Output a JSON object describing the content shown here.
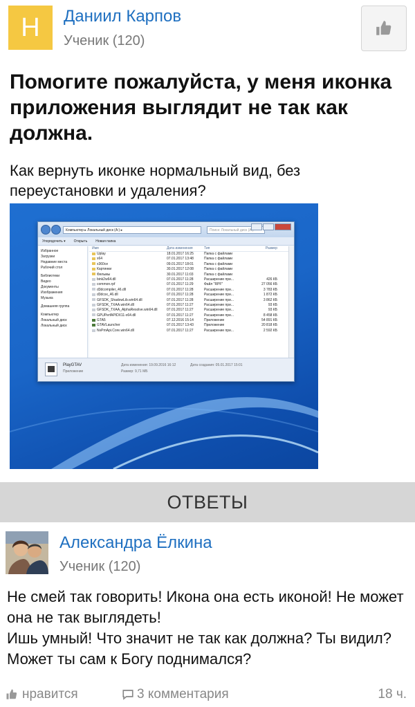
{
  "question": {
    "author": {
      "avatar_letter": "Н",
      "name": "Даниил Карпов",
      "rank": "Ученик (120)"
    },
    "like_icon": "thumbs-up-icon",
    "title": "Помогите пожалуйста, у меня иконка приложения выглядит не так как должна.",
    "body": "Как вернуть иконке нормальный вид, без переустановки и удаления?",
    "screenshot": {
      "address": "Компьютер ▸ Локальный диск (A:) ▸",
      "search_placeholder": "Поиск: Локальный диск (A:)",
      "toolbar": [
        "Упорядочить ▾",
        "Открыть",
        "Новая папка"
      ],
      "nav": [
        "Избранное",
        "Загрузки",
        "Недавние места",
        "Рабочий стол",
        "Библиотеки",
        "Видео",
        "Документы",
        "Изображения",
        "Музыка",
        "Домашняя группа",
        "Компьютер",
        "Локальный диск",
        "Локальный диск"
      ],
      "columns": [
        "Имя",
        "Дата изменения",
        "Тип",
        "Размер"
      ],
      "files": [
        {
          "name": "Uplay",
          "date": "18.01.2017 16:25",
          "type": "Папка с файлами",
          "size": "",
          "kind": "folder"
        },
        {
          "name": "x64",
          "date": "07.01.2017 13:48",
          "type": "Папка с файлами",
          "size": "",
          "kind": "folder"
        },
        {
          "name": "x360ce",
          "date": "09.01.2017 18:01",
          "type": "Папка с файлами",
          "size": "",
          "kind": "folder"
        },
        {
          "name": "Картинки",
          "date": "30.01.2017 12:08",
          "type": "Папка с файлами",
          "size": "",
          "kind": "folder"
        },
        {
          "name": "Фильмы",
          "date": "30.01.2017 11:03",
          "type": "Папка с файлами",
          "size": "",
          "kind": "folder"
        },
        {
          "name": "bink2w64.dll",
          "date": "07.01.2017 11:28",
          "type": "Расширение при...",
          "size": "426 КБ",
          "kind": "file"
        },
        {
          "name": "common.rpf",
          "date": "07.01.2017 11:29",
          "type": "Файл \"RPF\"",
          "size": "27 056 КБ",
          "kind": "file"
        },
        {
          "name": "d3dcompiler_46.dll",
          "date": "07.01.2017 11:28",
          "type": "Расширение при...",
          "size": "3 783 КБ",
          "kind": "file"
        },
        {
          "name": "d3dcsx_46.dll",
          "date": "07.01.2017 11:28",
          "type": "Расширение при...",
          "size": "1 872 КБ",
          "kind": "file"
        },
        {
          "name": "GFSDK_ShadowLib.win64.dll",
          "date": "07.01.2017 11:28",
          "type": "Расширение при...",
          "size": "3 862 КБ",
          "kind": "file"
        },
        {
          "name": "GFSDK_TXAA.win64.dll",
          "date": "07.01.2017 11:27",
          "type": "Расширение при...",
          "size": "93 КБ",
          "kind": "file"
        },
        {
          "name": "GFSDK_TXAA_AlphaResolve.win64.dll",
          "date": "07.01.2017 11:27",
          "type": "Расширение при...",
          "size": "93 КБ",
          "kind": "file"
        },
        {
          "name": "GPUPerfAPIDX11-x64.dll",
          "date": "07.01.2017 11:27",
          "type": "Расширение при...",
          "size": "8 458 КБ",
          "kind": "file"
        },
        {
          "name": "GTA5",
          "date": "07.12.2016 15:14",
          "type": "Приложение",
          "size": "54 891 КБ",
          "kind": "app"
        },
        {
          "name": "GTAVLauncher",
          "date": "07.01.2017 13:43",
          "type": "Приложение",
          "size": "20 818 КБ",
          "kind": "app"
        },
        {
          "name": "NvPmApi.Core.win64.dll",
          "date": "07.01.2017 11:27",
          "type": "Расширение при...",
          "size": "2 592 КБ",
          "kind": "file"
        }
      ],
      "details": {
        "name": "PlayGTAV",
        "type": "Приложение",
        "modified": "Дата изменения: 19.09.2016 16:12",
        "size": "Размер: 9,71 МБ",
        "created": "Дата создания: 05.01.2017 15:01"
      }
    }
  },
  "answers_header": "ОТВЕТЫ",
  "answer": {
    "author": {
      "name": "Александра Ёлкина",
      "rank": "Ученик (120)"
    },
    "lines": [
      "Не смей так говорить! Икона она есть иконой! Не может она не так выглядеть!",
      "Ишь умный! Что значит не так как должна? Ты видил? Может ты сам к Богу поднимался?"
    ],
    "like_label": "нравится",
    "comments_label": "3 комментария",
    "time": "18 ч."
  },
  "colors": {
    "link_blue": "#1e6fc0",
    "avatar_yellow": "#f5c842",
    "answers_bar": "#d6d6d6",
    "muted": "#777777"
  }
}
